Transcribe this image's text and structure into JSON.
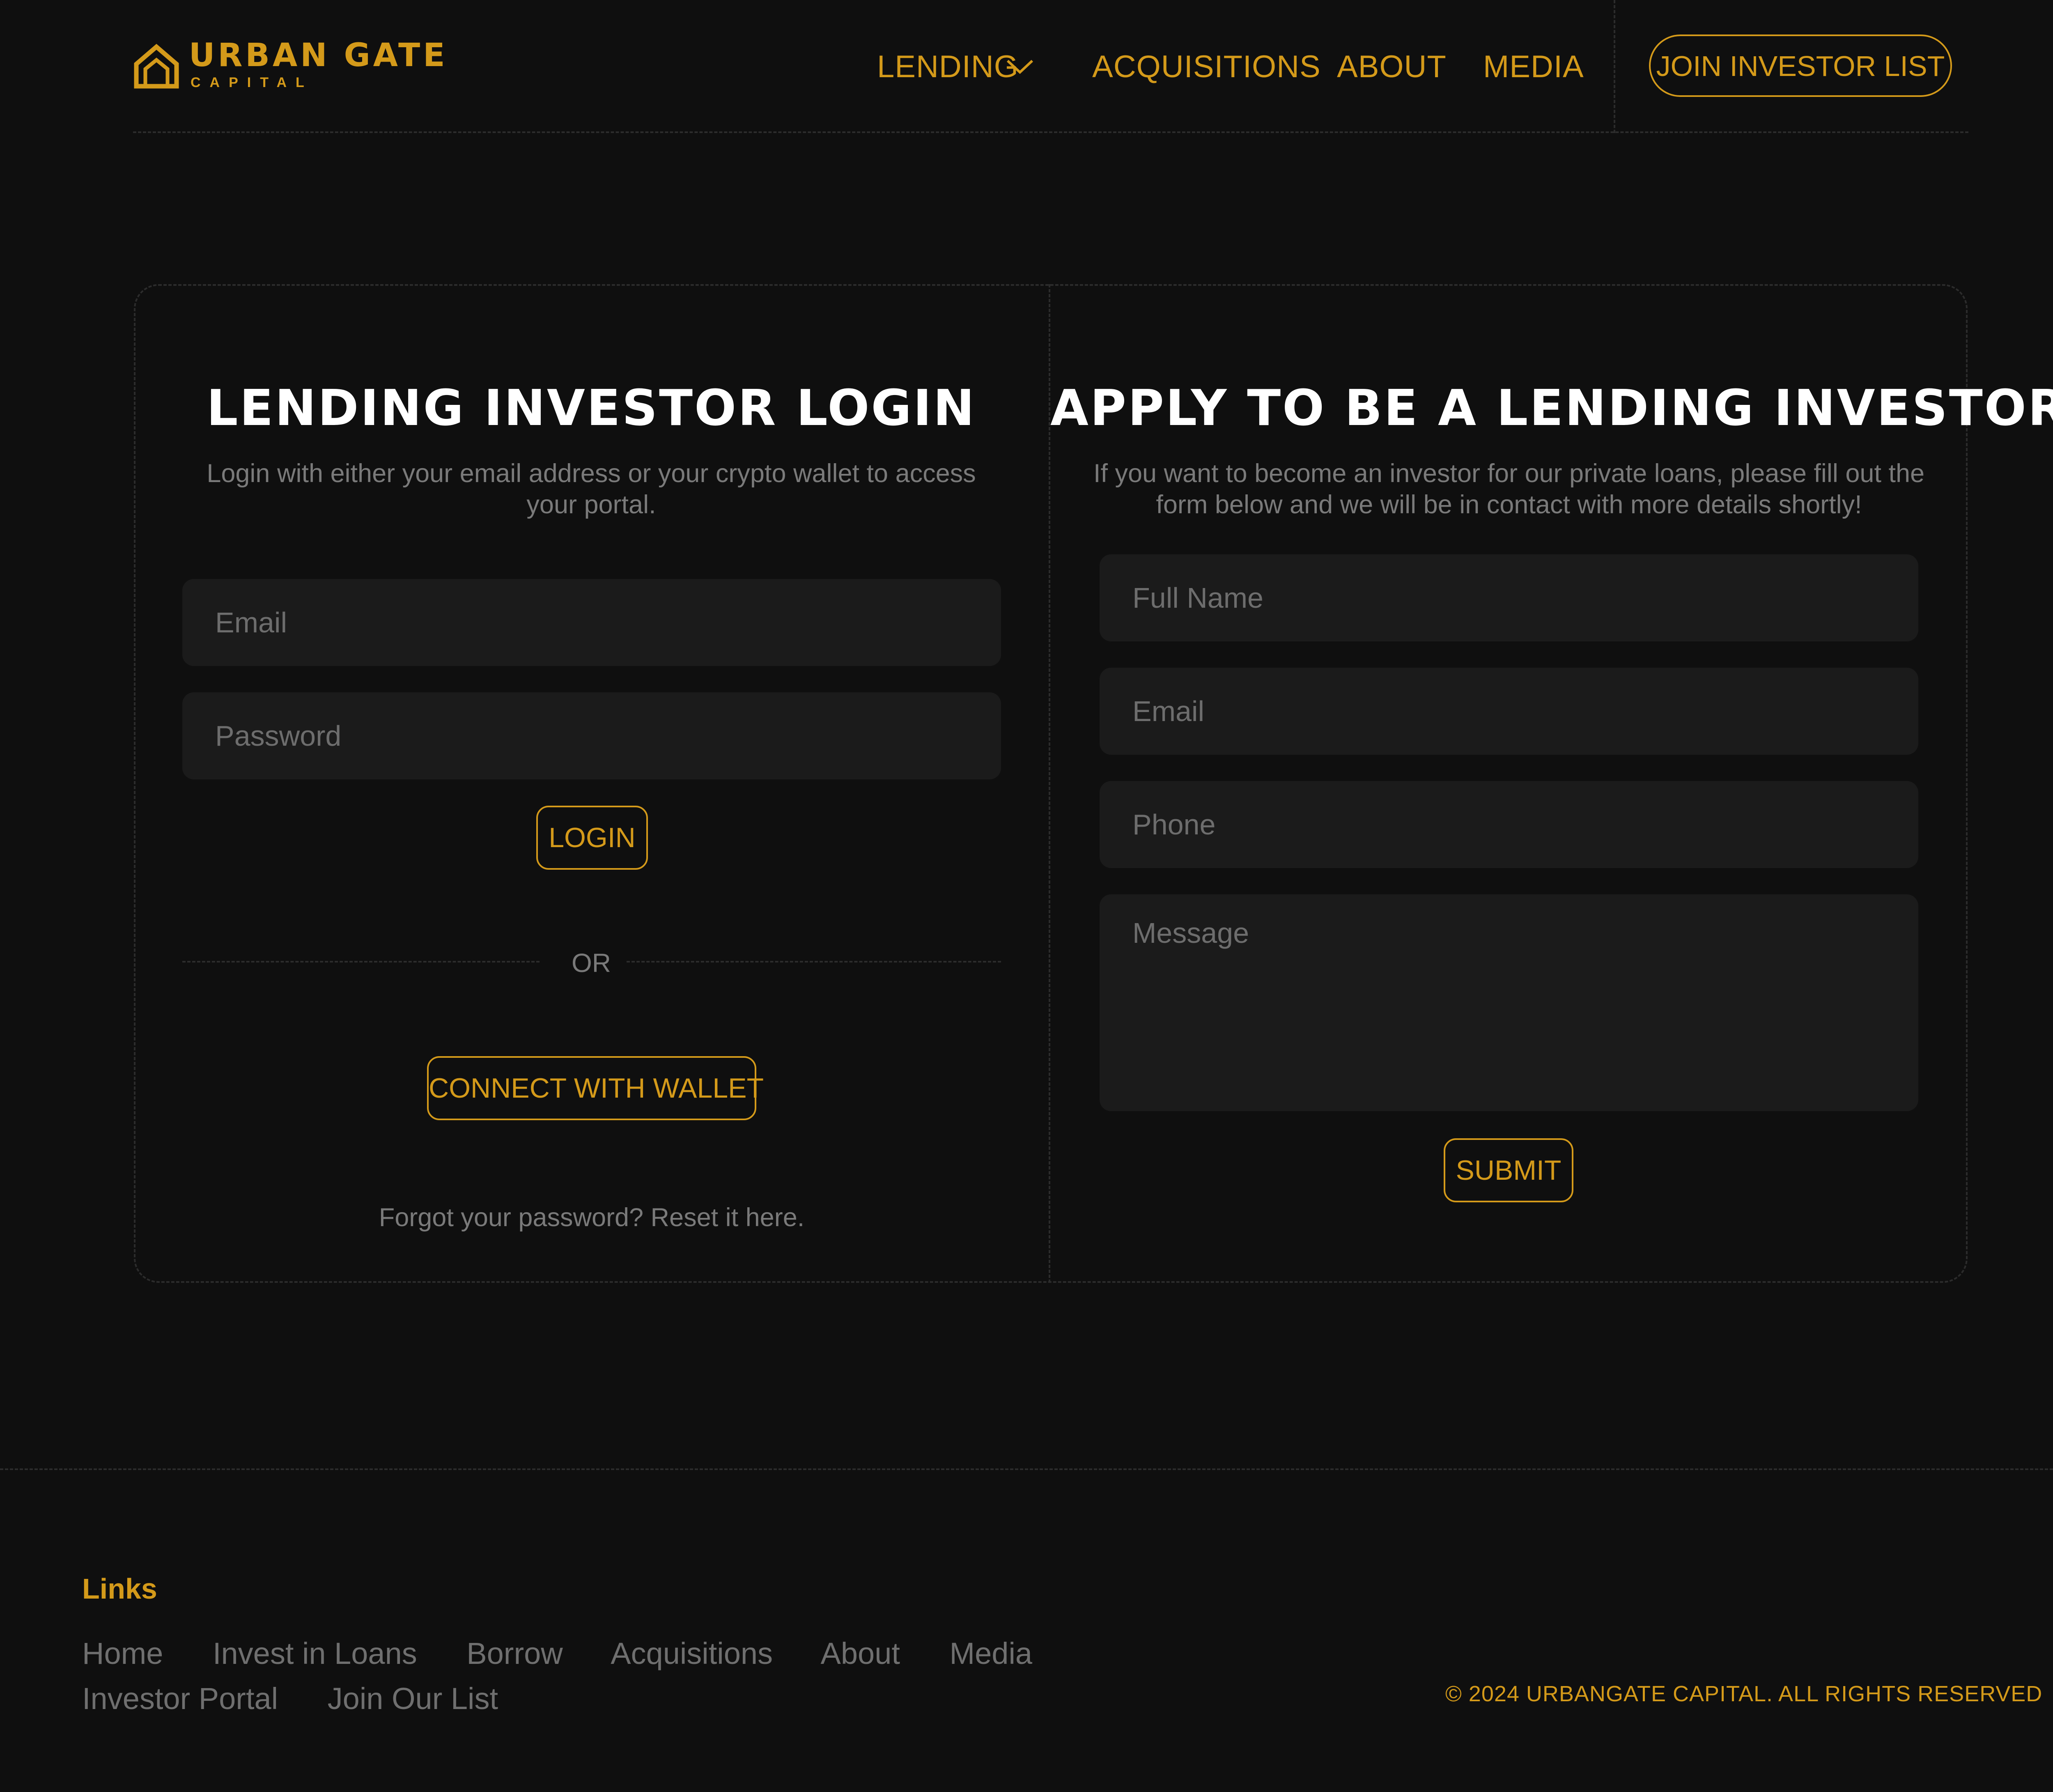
{
  "brand": {
    "name": "URBAN GATE",
    "sub": "CAPITAL",
    "accent_color": "#d49a1a",
    "background_color": "#0f0f0f",
    "logo_icon": "house-icon"
  },
  "nav": {
    "items": [
      {
        "label": "LENDING",
        "has_dropdown": true
      },
      {
        "label": "ACQUISITIONS"
      },
      {
        "label": "ABOUT"
      },
      {
        "label": "MEDIA"
      }
    ],
    "dropdown_icon": "chevron-down-icon",
    "cta_label": "JOIN INVESTOR LIST"
  },
  "login": {
    "title": "LENDING INVESTOR LOGIN",
    "description": "Login with either your email address or your crypto wallet to access your portal.",
    "email_placeholder": "Email",
    "password_placeholder": "Password",
    "login_label": "LOGIN",
    "or_label": "OR",
    "wallet_label": "CONNECT WITH WALLET",
    "forgot_text": "Forgot your password? Reset it here."
  },
  "apply": {
    "title": "APPLY TO BE A LENDING INVESTOR",
    "description": "If you want to become an investor for our private loans, please fill out the form below and we will be in contact with more details shortly!",
    "name_placeholder": "Full Name",
    "email_placeholder": "Email",
    "phone_placeholder": "Phone",
    "message_placeholder": "Message",
    "submit_label": "SUBMIT"
  },
  "footer": {
    "heading": "Links",
    "links": [
      "Home",
      "Invest in Loans",
      "Borrow",
      "Acquisitions",
      "About",
      "Media",
      "Investor Portal",
      "Join Our List"
    ],
    "copyright": "© 2024 URBANGATE CAPITAL. ALL RIGHTS RESERVED"
  }
}
